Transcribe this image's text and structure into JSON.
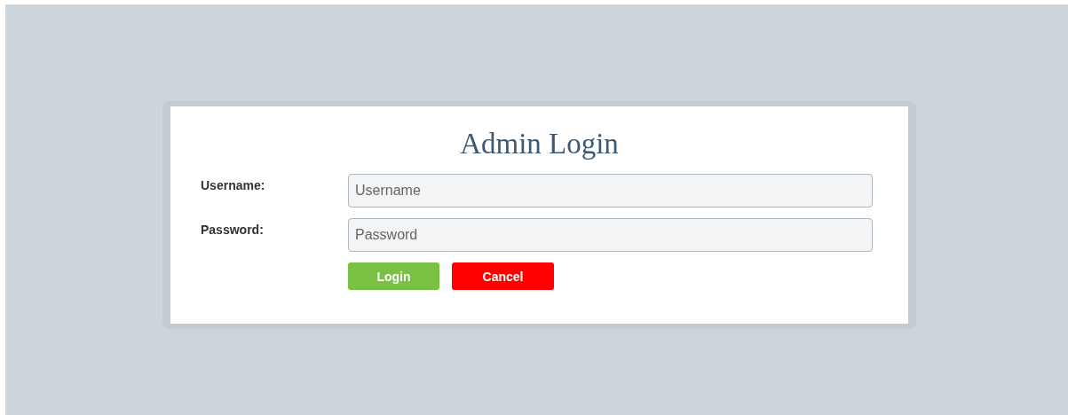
{
  "title": "Admin Login",
  "fields": [
    {
      "label": "Username:",
      "placeholder": "Username"
    },
    {
      "label": "Password:",
      "placeholder": "Password"
    }
  ],
  "buttons": [
    {
      "label": "Login",
      "kind": "primary"
    },
    {
      "label": "Cancel",
      "kind": "danger"
    }
  ]
}
